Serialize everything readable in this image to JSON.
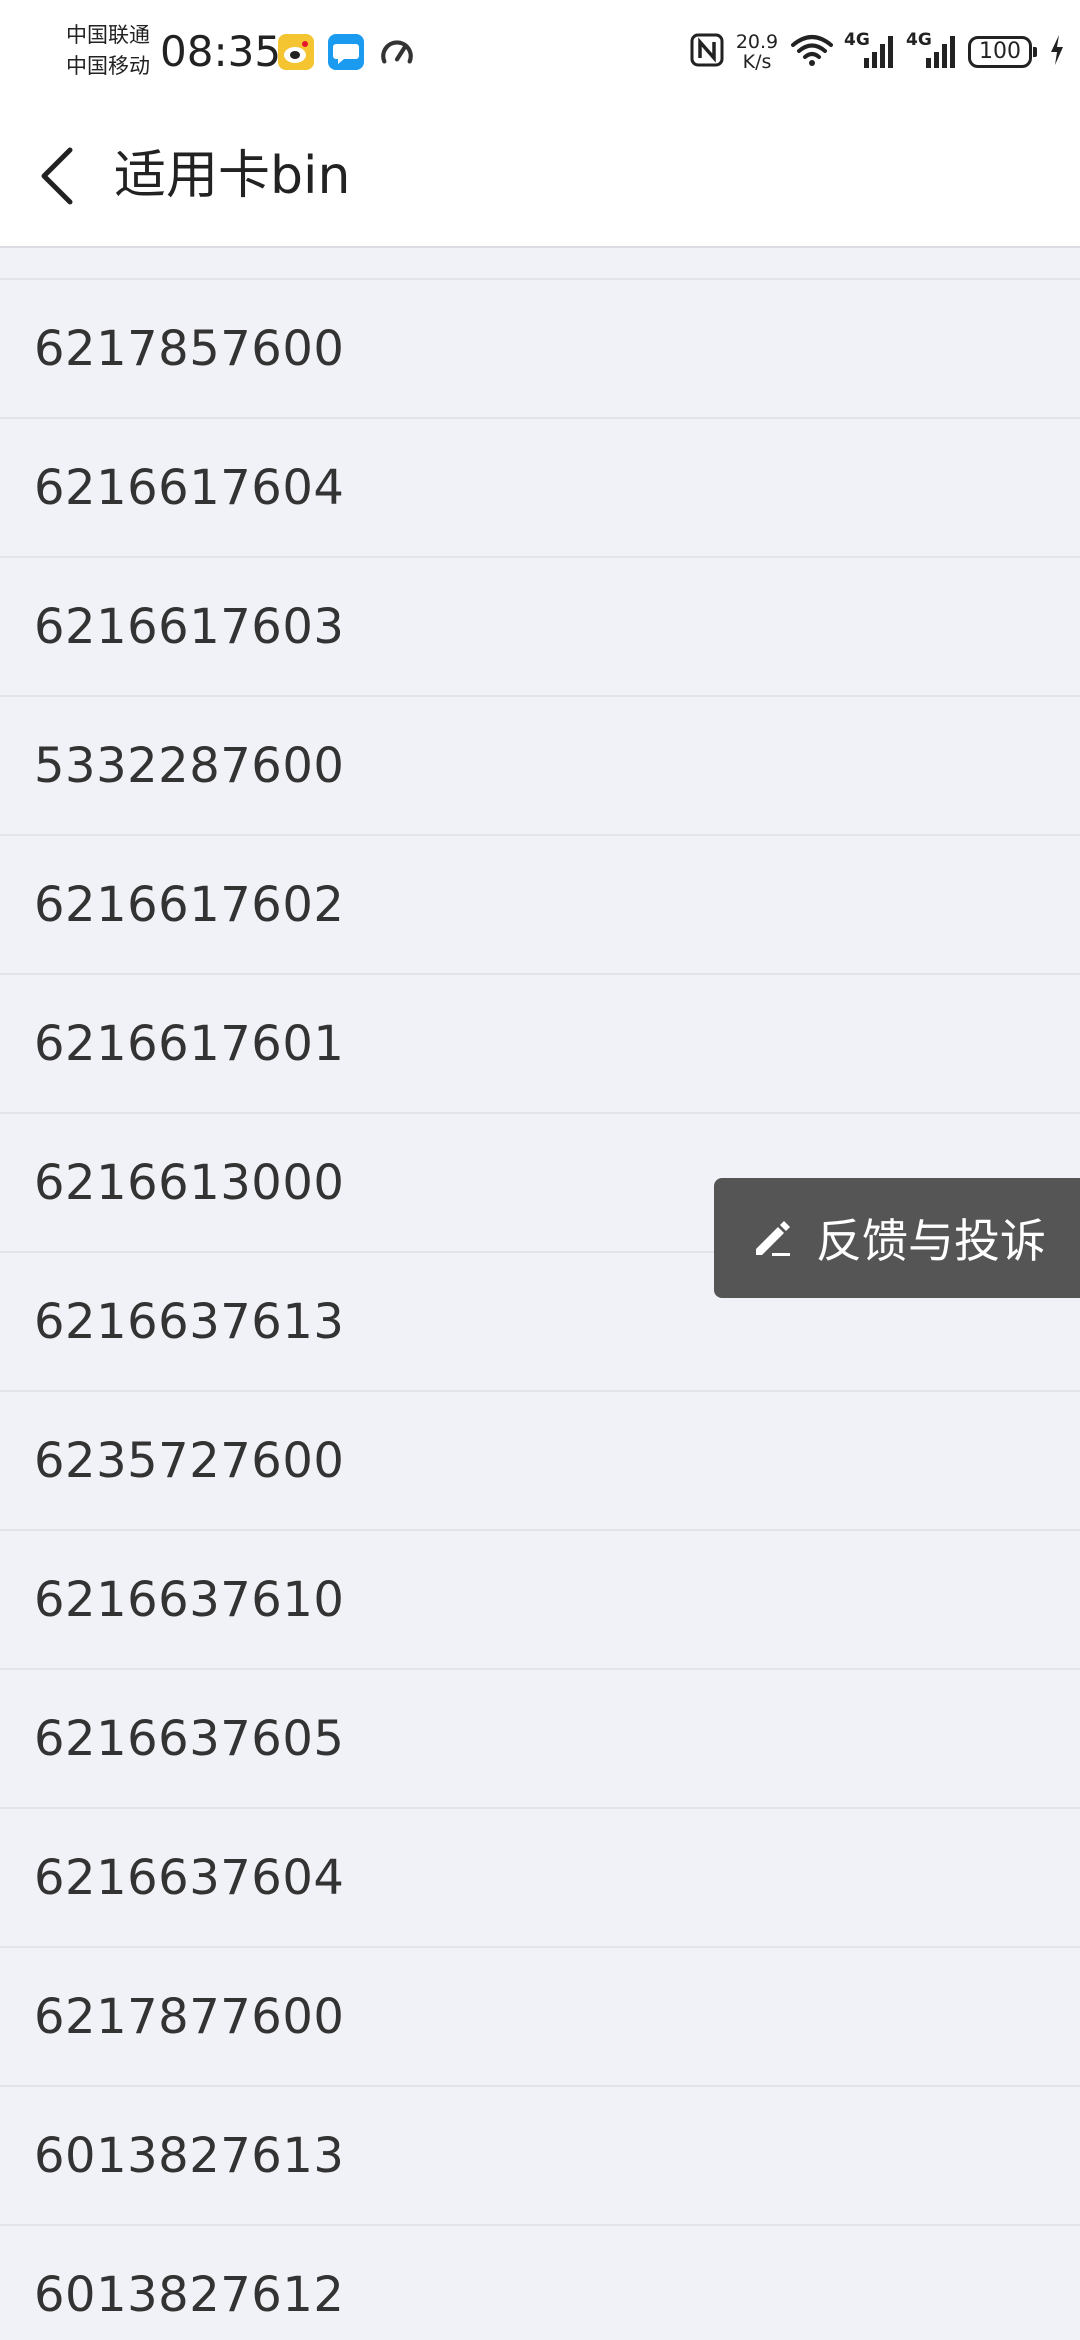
{
  "status_bar": {
    "carrier_1": "中国联通",
    "carrier_2": "中国移动",
    "time": "08:35",
    "net_speed_value": "20.9",
    "net_speed_unit": "K/s",
    "signal_1_label": "4G",
    "signal_2_label": "4G",
    "battery": "100"
  },
  "header": {
    "title": "适用卡bin"
  },
  "card_bins": [
    "6217857600",
    "6216617604",
    "6216617603",
    "5332287600",
    "6216617602",
    "6216617601",
    "6216613000",
    "6216637613",
    "6235727600",
    "6216637610",
    "6216637605",
    "6216637604",
    "6217877600",
    "6013827613",
    "6013827612"
  ],
  "feedback": {
    "label": "反馈与投诉"
  },
  "icons": {
    "back": "chevron-left-icon",
    "feedback": "pencil-icon"
  }
}
